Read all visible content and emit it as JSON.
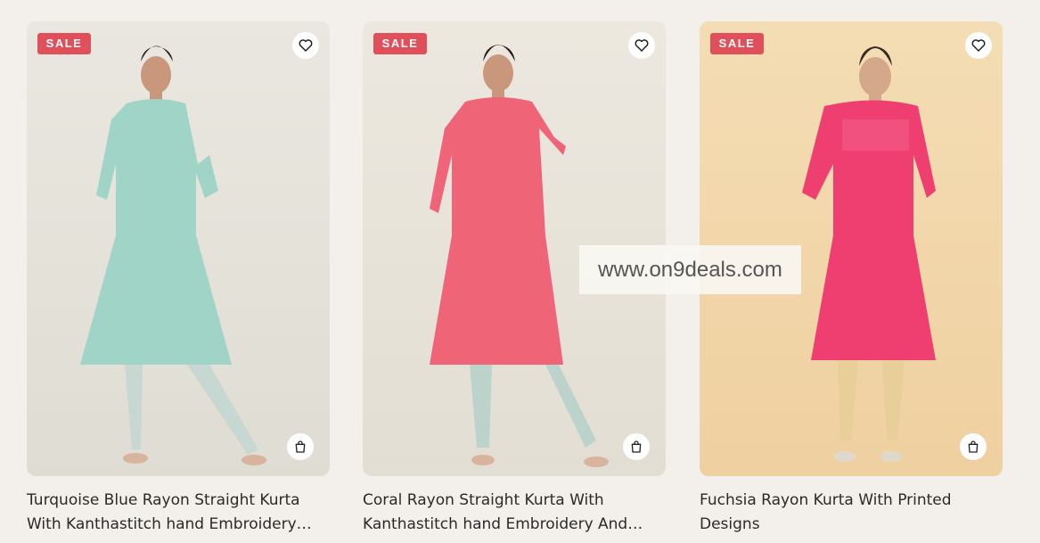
{
  "products": [
    {
      "badge": "SALE",
      "title": "Turquoise Blue Rayon Straight Kurta With Kanthastitch hand Embroidery And Mirror Work",
      "kurta_color": "#9fd4c6",
      "pants_color": "#c7d8d2"
    },
    {
      "badge": "SALE",
      "title": "Coral Rayon Straight Kurta With Kanthastitch hand Embroidery And Mirror Work",
      "kurta_color": "#ef6477",
      "pants_color": "#bcd3cc"
    },
    {
      "badge": "SALE",
      "title": "Fuchsia Rayon Kurta With Printed Designs",
      "kurta_color": "#ee3f70",
      "pants_color": "#e8cf9a"
    }
  ],
  "watermark": "www.on9deals.com",
  "colors": {
    "sale_badge": "#e0505b",
    "page_background": "#f3f0eb",
    "title_text": "#2a2a2a"
  },
  "icons": {
    "wishlist": "heart-icon",
    "add_to_bag": "shopping-bag-icon"
  }
}
